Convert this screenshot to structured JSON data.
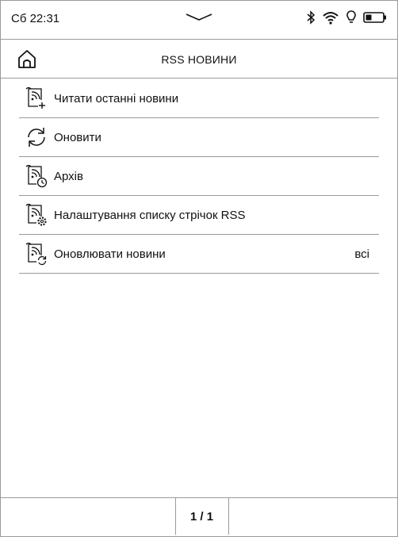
{
  "status_bar": {
    "time": "Сб 22:31",
    "icons": [
      "chevron-down-icon",
      "bluetooth-icon",
      "wifi-icon",
      "light-bulb-icon",
      "battery-icon"
    ]
  },
  "header": {
    "title": "RSS НОВИНИ",
    "home_icon": "home-icon"
  },
  "menu": {
    "items": [
      {
        "label": "Читати останні новини",
        "icon": "rss-read-icon"
      },
      {
        "label": "Оновити",
        "icon": "refresh-icon"
      },
      {
        "label": "Архів",
        "icon": "rss-archive-icon"
      },
      {
        "label": "Налаштування списку стрічок RSS",
        "icon": "rss-settings-icon"
      },
      {
        "label": "Оновлювати новини",
        "icon": "rss-update-icon",
        "value": "всі"
      }
    ]
  },
  "footer": {
    "page": "1 / 1"
  }
}
